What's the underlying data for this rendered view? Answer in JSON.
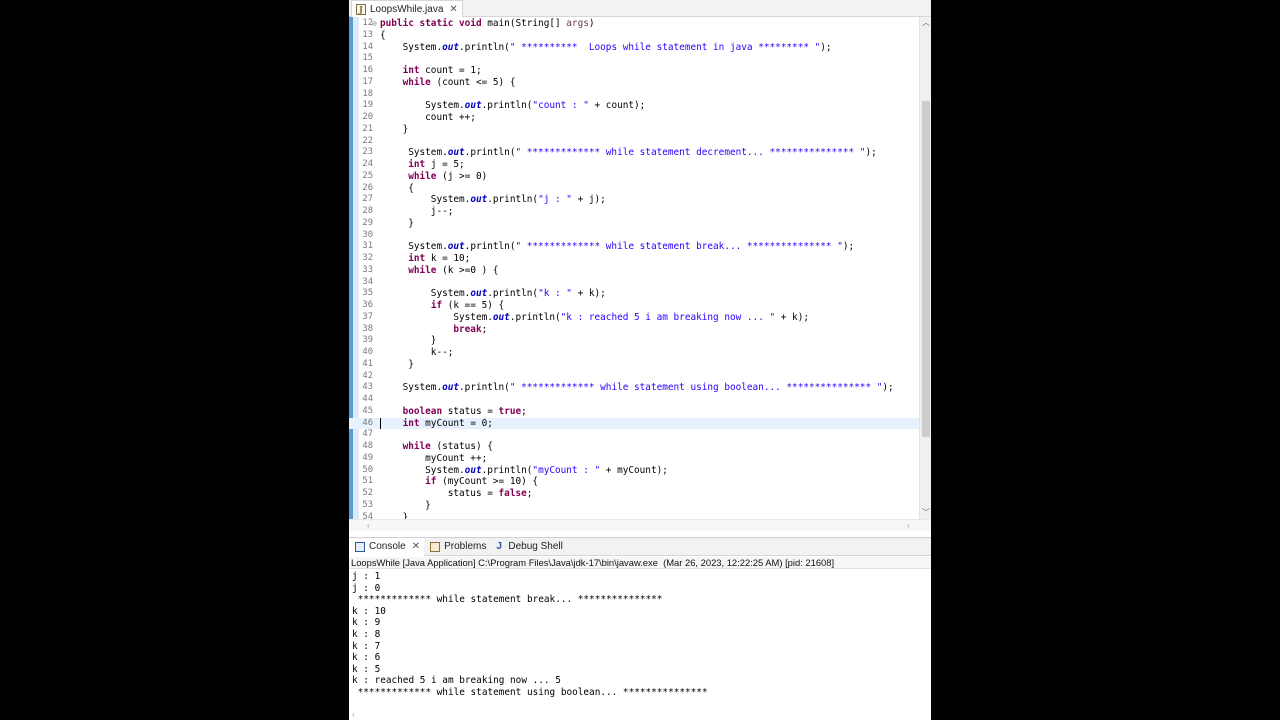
{
  "editor_tab": {
    "icon": "J",
    "title": "LoopsWhile.java",
    "close": "✕"
  },
  "editor_lines": [
    {
      "n": "12",
      "fold": "⊖",
      "html": "<span class=\"kw\">public static void</span> main(String[] <span class=\"param\">args</span>)"
    },
    {
      "n": "13",
      "html": "{"
    },
    {
      "n": "14",
      "html": "    System.<span class=\"fld\">out</span>.println(<span class=\"str\">\" **********  Loops while statement in java ********* \"</span>);"
    },
    {
      "n": "15",
      "html": ""
    },
    {
      "n": "16",
      "html": "    <span class=\"kw\">int</span> count = 1;"
    },
    {
      "n": "17",
      "html": "    <span class=\"kw\">while</span> (count &lt;= 5) {"
    },
    {
      "n": "18",
      "html": ""
    },
    {
      "n": "19",
      "html": "        System.<span class=\"fld\">out</span>.println(<span class=\"str\">\"count : \"</span> + count);"
    },
    {
      "n": "20",
      "html": "        count ++;"
    },
    {
      "n": "21",
      "html": "    }"
    },
    {
      "n": "22",
      "html": ""
    },
    {
      "n": "23",
      "html": "     System.<span class=\"fld\">out</span>.println(<span class=\"str\">\" ************* while statement decrement... *************** \"</span>);"
    },
    {
      "n": "24",
      "html": "     <span class=\"kw\">int</span> j = 5;"
    },
    {
      "n": "25",
      "html": "     <span class=\"kw\">while</span> (j &gt;= 0)"
    },
    {
      "n": "26",
      "html": "     {"
    },
    {
      "n": "27",
      "html": "         System.<span class=\"fld\">out</span>.println(<span class=\"str\">\"j : \"</span> + j);"
    },
    {
      "n": "28",
      "html": "         j--;"
    },
    {
      "n": "29",
      "html": "     }"
    },
    {
      "n": "30",
      "html": ""
    },
    {
      "n": "31",
      "html": "     System.<span class=\"fld\">out</span>.println(<span class=\"str\">\" ************* while statement break... *************** \"</span>);"
    },
    {
      "n": "32",
      "html": "     <span class=\"kw\">int</span> k = 10;"
    },
    {
      "n": "33",
      "html": "     <span class=\"kw\">while</span> (k &gt;=0 ) {"
    },
    {
      "n": "34",
      "html": ""
    },
    {
      "n": "35",
      "html": "         System.<span class=\"fld\">out</span>.println(<span class=\"str\">\"k : \"</span> + k);"
    },
    {
      "n": "36",
      "html": "         <span class=\"kw\">if</span> (k == 5) {"
    },
    {
      "n": "37",
      "html": "             System.<span class=\"fld\">out</span>.println(<span class=\"str\">\"k : reached 5 i am breaking now ... \"</span> + k);"
    },
    {
      "n": "38",
      "html": "             <span class=\"kw\">break</span>;"
    },
    {
      "n": "39",
      "html": "         }"
    },
    {
      "n": "40",
      "html": "         k--;"
    },
    {
      "n": "41",
      "html": "     }"
    },
    {
      "n": "42",
      "html": ""
    },
    {
      "n": "43",
      "html": "    System.<span class=\"fld\">out</span>.println(<span class=\"str\">\" ************* while statement using boolean... *************** \"</span>);"
    },
    {
      "n": "44",
      "html": ""
    },
    {
      "n": "45",
      "html": "    <span class=\"kw\">boolean</span> status = <span class=\"kw\">true</span>;"
    },
    {
      "n": "46",
      "current": true,
      "html": "    <span class=\"kw\">int</span> myCount = 0;"
    },
    {
      "n": "47",
      "html": ""
    },
    {
      "n": "48",
      "html": "    <span class=\"kw\">while</span> (status) {"
    },
    {
      "n": "49",
      "html": "        myCount ++;"
    },
    {
      "n": "50",
      "html": "        System.<span class=\"fld\">out</span>.println(<span class=\"str\">\"myCount : \"</span> + myCount);"
    },
    {
      "n": "51",
      "html": "        <span class=\"kw\">if</span> (myCount &gt;= 10) {"
    },
    {
      "n": "52",
      "html": "            status = <span class=\"kw\">false</span>;"
    },
    {
      "n": "53",
      "html": "        }"
    },
    {
      "n": "54",
      "html": "    }"
    }
  ],
  "console_tabs": [
    {
      "icon": "console",
      "label": "Console",
      "active": true,
      "closable": true
    },
    {
      "icon": "problems",
      "label": "Problems",
      "active": false,
      "closable": false
    },
    {
      "icon": "debug",
      "label": "Debug Shell",
      "active": false,
      "closable": false
    }
  ],
  "launch_info": "LoopsWhile [Java Application] C:\\Program Files\\Java\\jdk-17\\bin\\javaw.exe  (Mar 26, 2023, 12:22:25 AM) [pid: 21608]",
  "console_output": [
    "j : 1",
    "j : 0",
    " ************* while statement break... ***************",
    "k : 10",
    "k : 9",
    "k : 8",
    "k : 7",
    "k : 6",
    "k : 5",
    "k : reached 5 i am breaking now ... 5",
    " ************* while statement using boolean... ***************"
  ],
  "colors": {
    "keyword": "#7f0055",
    "string": "#2a00ff",
    "field": "#0000c0",
    "current_line": "#e8f2fe"
  }
}
